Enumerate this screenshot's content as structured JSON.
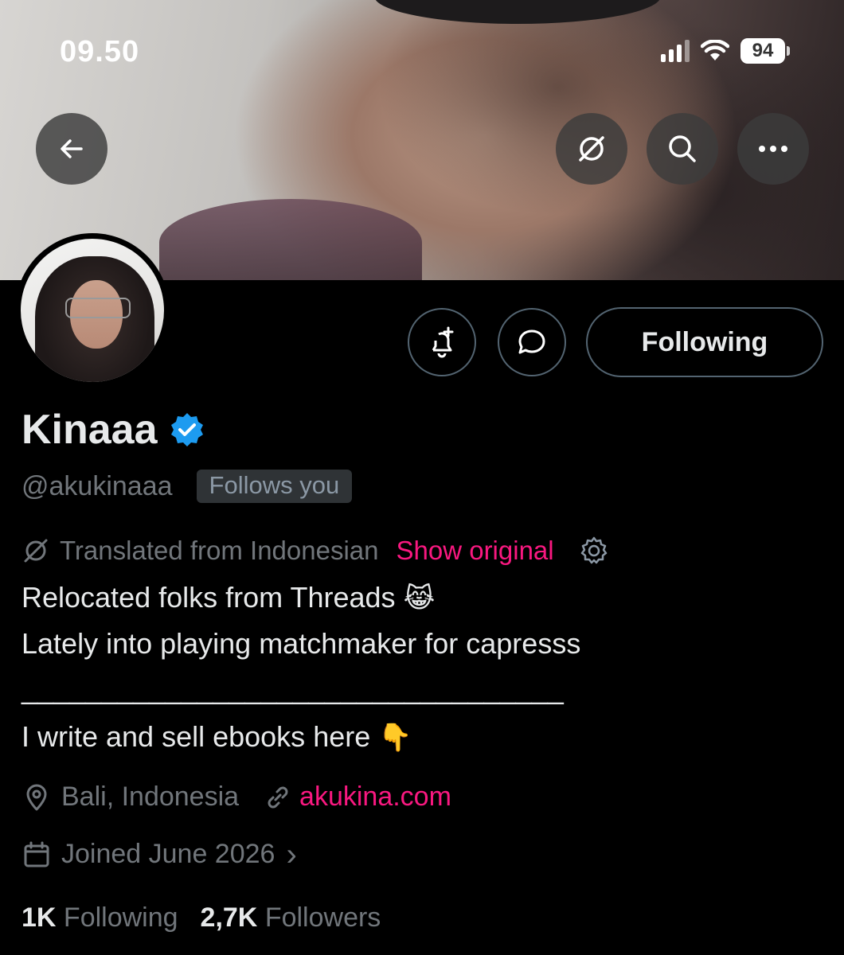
{
  "status_bar": {
    "time": "09.50",
    "battery": "94"
  },
  "profile": {
    "name": "Kinaaa",
    "handle": "@akukinaaa",
    "follows_you": "Follows you",
    "follow_button": "Following"
  },
  "translation": {
    "label": "Translated from Indonesian",
    "show_original": "Show original"
  },
  "bio": {
    "line1": "Relocated folks from Threads",
    "line1_emoji": "😹",
    "line2": "Lately into playing matchmaker for capresss",
    "divider": "__________________________________",
    "line3": "I write and sell ebooks here",
    "line3_emoji": "👇"
  },
  "meta": {
    "location": "Bali, Indonesia",
    "website": "akukina.com",
    "joined": "Joined June 2026",
    "joined_chevron": "›"
  },
  "stats": {
    "following_count": "1K",
    "following_label": "Following",
    "followers_count": "2,7K",
    "followers_label": "Followers"
  },
  "colors": {
    "accent_link": "#f91880",
    "verified": "#1d9bf0",
    "muted_text": "#71767b"
  },
  "icons": [
    "back-arrow-icon",
    "translate-icon",
    "search-icon",
    "more-icon",
    "notification-bell-icon",
    "message-icon",
    "verified-badge-icon",
    "settings-gear-icon",
    "location-pin-icon",
    "link-icon",
    "calendar-icon",
    "signal-icon",
    "wifi-icon",
    "battery-icon"
  ]
}
